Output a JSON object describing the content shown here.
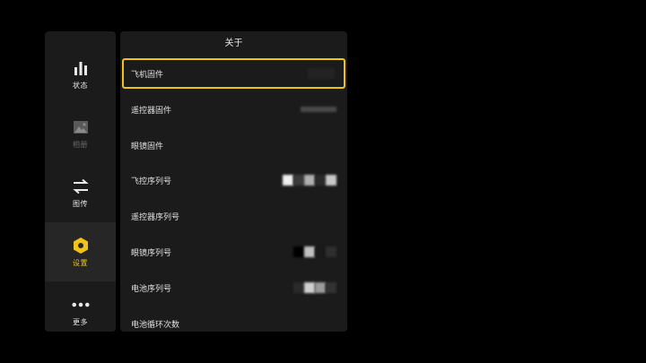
{
  "sidebar": {
    "items": [
      {
        "label": "状态",
        "icon": "bar-chart-icon"
      },
      {
        "label": "相册",
        "icon": "image-icon"
      },
      {
        "label": "图传",
        "icon": "swap-arrows-icon"
      },
      {
        "label": "设置",
        "icon": "hexagon-gear-icon"
      },
      {
        "label": "更多",
        "icon": "more-dots-icon"
      }
    ],
    "active_index": 3
  },
  "panel": {
    "title": "关于",
    "rows": [
      {
        "label": "飞机固件"
      },
      {
        "label": "遥控器固件"
      },
      {
        "label": "眼镜固件"
      },
      {
        "label": "飞控序列号"
      },
      {
        "label": "遥控器序列号"
      },
      {
        "label": "眼镜序列号"
      },
      {
        "label": "电池序列号"
      },
      {
        "label": "电池循环次数"
      }
    ],
    "selected_index": 0
  },
  "colors": {
    "accent": "#f2c316",
    "panel_bg": "#1b1b1b",
    "background": "#000000"
  }
}
